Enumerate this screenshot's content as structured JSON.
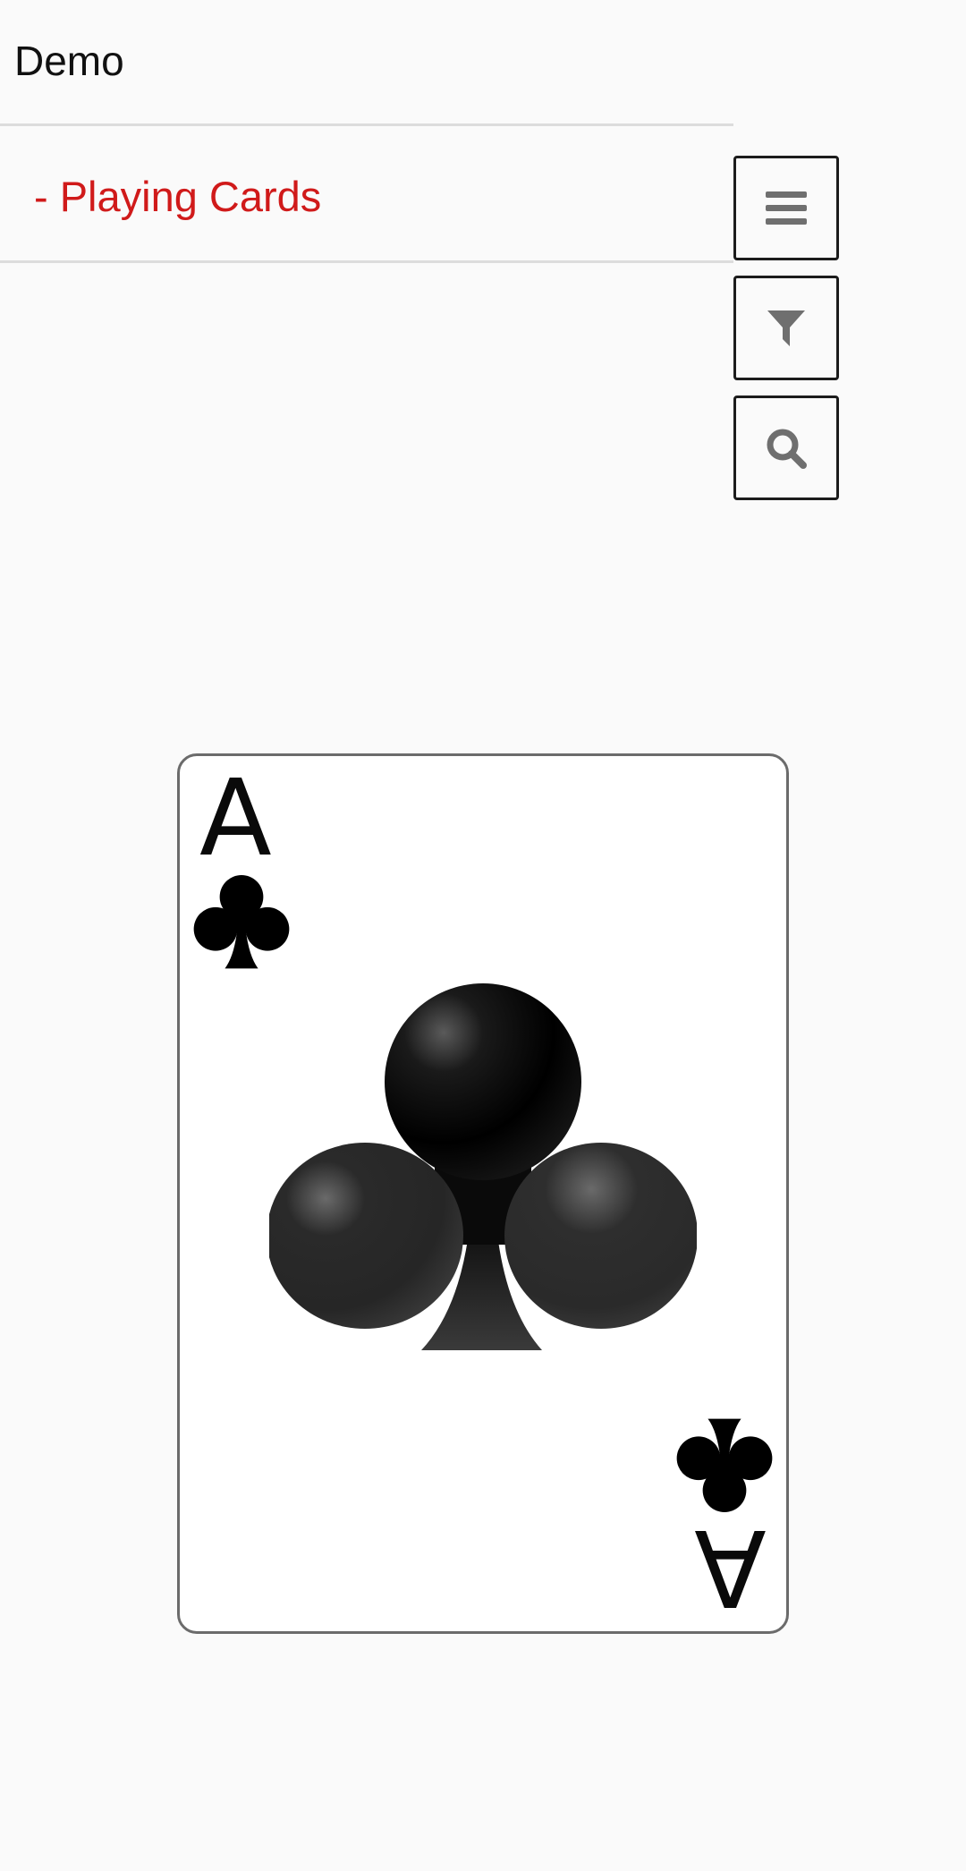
{
  "app": {
    "title": "Demo"
  },
  "section": {
    "title": "- Playing Cards"
  },
  "toolbar": {
    "buttons": [
      {
        "icon": "menu-icon"
      },
      {
        "icon": "filter-icon"
      },
      {
        "icon": "search-icon"
      }
    ],
    "icon_color": "#6f6f6f"
  },
  "card": {
    "rank": "A",
    "suit": "clubs",
    "suit_color": "#000000"
  },
  "colors": {
    "accent": "#d01a1a",
    "background": "#fafafa",
    "divider": "#dcdcdc"
  }
}
